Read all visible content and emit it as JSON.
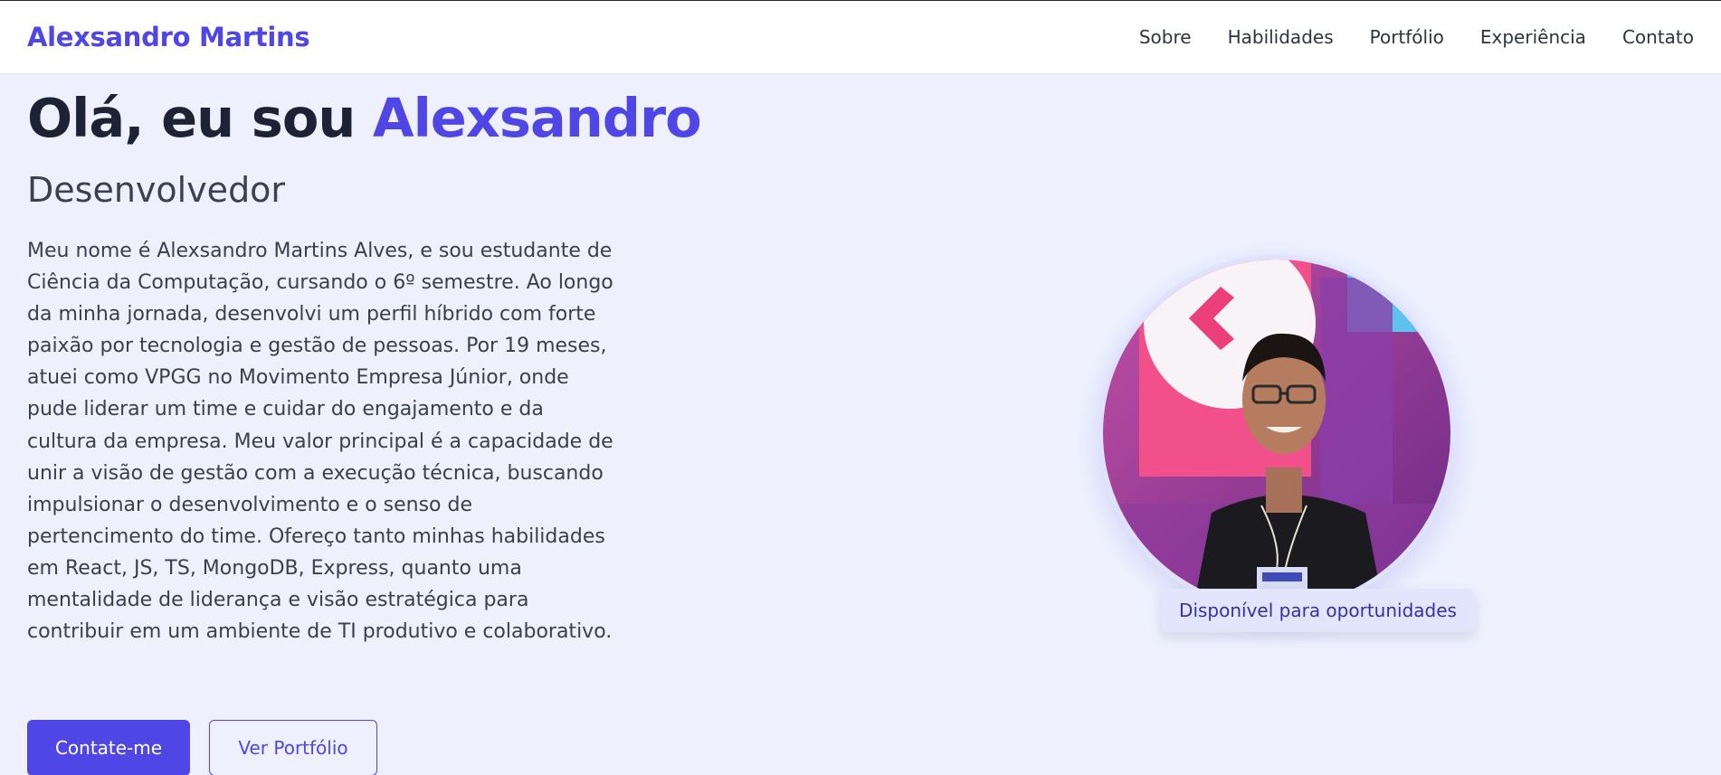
{
  "nav": {
    "brand": "Alexsandro Martins",
    "links": [
      "Sobre",
      "Habilidades",
      "Portfólio",
      "Experiência",
      "Contato"
    ]
  },
  "hero": {
    "greeting": "Olá, eu sou",
    "name": "Alexsandro",
    "role": "Desenvolvedor",
    "bio": "Meu nome é Alexsandro Martins Alves, e sou estudante de Ciência da Computação, cursando o 6º semestre. Ao longo da minha jornada, desenvolvi um perfil híbrido com forte paixão por tecnologia e gestão de pessoas. Por 19 meses, atuei como VPGG no Movimento Empresa Júnior, onde pude liderar um time e cuidar do engajamento e da cultura da empresa. Meu valor principal é a capacidade de unir a visão de gestão com a execução técnica, buscando impulsionar o desenvolvimento e o senso de pertencimento do time. Ofereço tanto minhas habilidades em React, JS, TS, MongoDB, Express, quanto uma mentalidade de liderança e visão estratégica para contribuir em um ambiente de TI produtivo e colaborativo.",
    "primary_button": "Contate-me",
    "secondary_button": "Ver Portfólio",
    "availability": "Disponível para oportunidades"
  },
  "colors": {
    "accent": "#4f46e5",
    "background": "#eef1fd"
  }
}
